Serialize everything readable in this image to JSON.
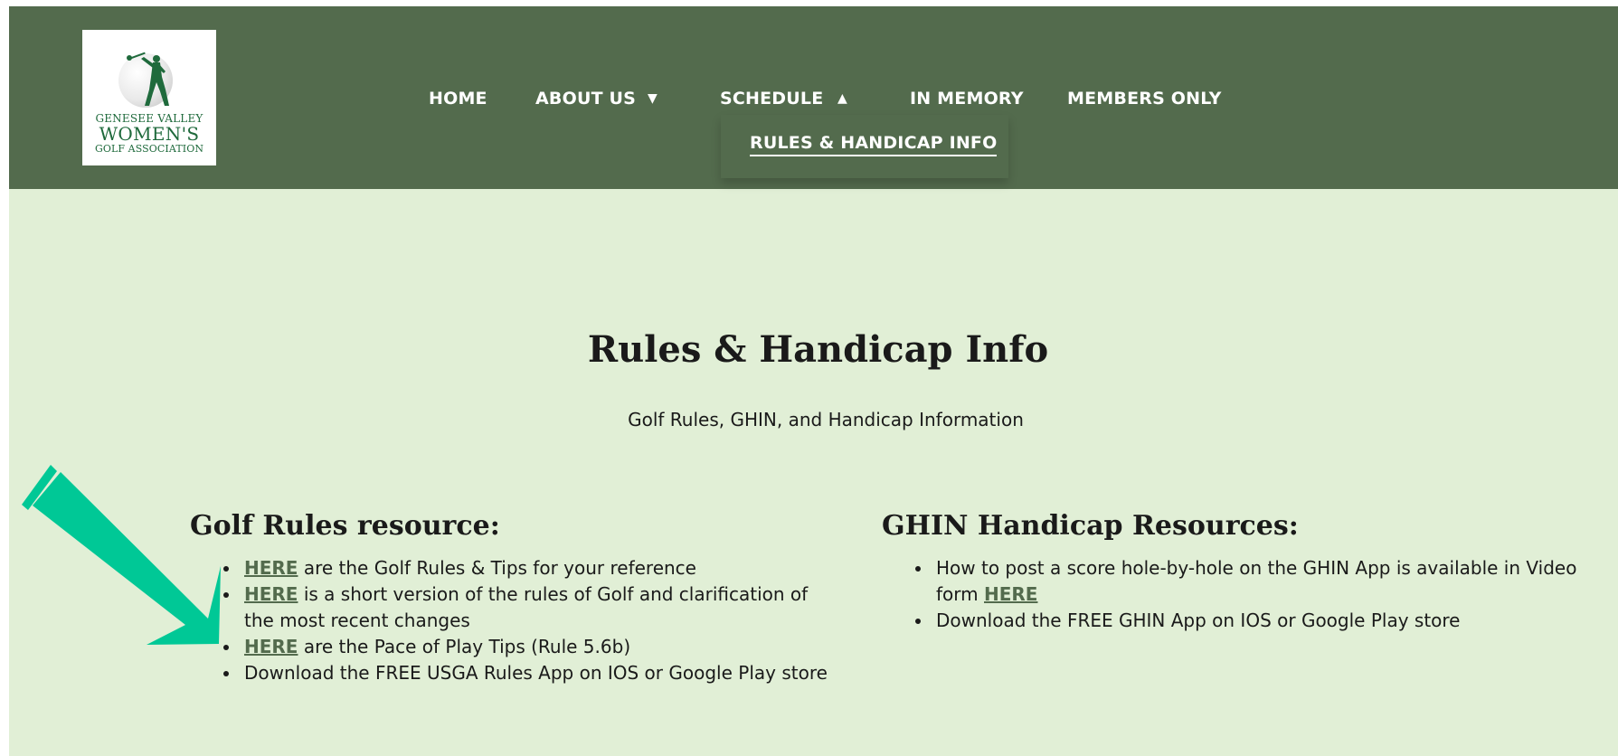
{
  "logo": {
    "line1": "GENESEE VALLEY",
    "line2": "WOMEN'S",
    "line3": "GOLF ASSOCIATION"
  },
  "nav": {
    "items": [
      "HOME",
      "ABOUT US",
      "SCHEDULE",
      "IN MEMORY",
      "MEMBERS ONLY"
    ],
    "about_caret": "▼",
    "schedule_caret": "▲",
    "dropdown_item": "RULES & HANDICAP INFO"
  },
  "page": {
    "title": "Rules & Handicap Info",
    "subtitle": "Golf Rules, GHIN, and Handicap Information"
  },
  "golf_rules": {
    "title": "Golf Rules resource:",
    "items": [
      {
        "link": "HERE",
        "text": " are the Golf Rules & Tips for your reference"
      },
      {
        "link": "HERE",
        "text": " is a short version of the rules of Golf and clarification of the most recent changes"
      },
      {
        "link": "HERE",
        "text": " are the Pace of Play Tips (Rule 5.6b)"
      },
      {
        "link": "",
        "text": "Download the FREE USGA Rules App on IOS or Google Play store"
      }
    ]
  },
  "ghin": {
    "title": "GHIN Handicap Resources:",
    "items": [
      {
        "before": "How to post a score hole-by-hole on the GHIN App is available in Video form ",
        "link": "HERE"
      },
      {
        "before": "Download the FREE GHIN App on IOS or Google Play store",
        "link": ""
      }
    ]
  },
  "colors": {
    "header": "#536b4d",
    "background": "#e1efd6",
    "link": "#536b4d",
    "arrow": "#00c896"
  }
}
